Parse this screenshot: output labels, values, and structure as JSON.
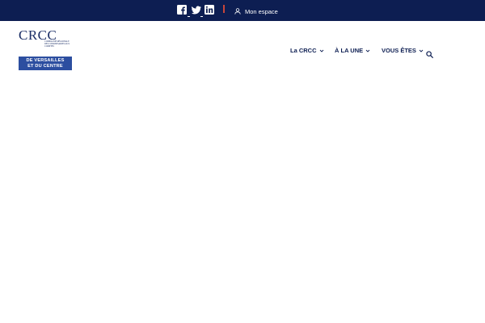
{
  "topbar": {
    "social": [
      {
        "name": "facebook",
        "icon": "facebook-icon"
      },
      {
        "name": "twitter",
        "icon": "twitter-icon"
      },
      {
        "name": "linkedin",
        "icon": "linkedin-icon"
      }
    ],
    "account_label": "Mon espace",
    "background": "#0d1e52",
    "separator_color": "#c8463a"
  },
  "logo": {
    "letters": "CRCC",
    "tagline": "Compagnie régionale des commissaires aux comptes",
    "plate_line1": "DE VERSAILLES",
    "plate_line2": "ET DU CENTRE",
    "plate_color": "#2c4ea0",
    "text_color": "#1b2e66"
  },
  "nav": {
    "items": [
      {
        "label": "La CRCC"
      },
      {
        "label": "À LA UNE"
      },
      {
        "label": "VOUS ÊTES"
      }
    ],
    "search_icon": "search-icon"
  }
}
